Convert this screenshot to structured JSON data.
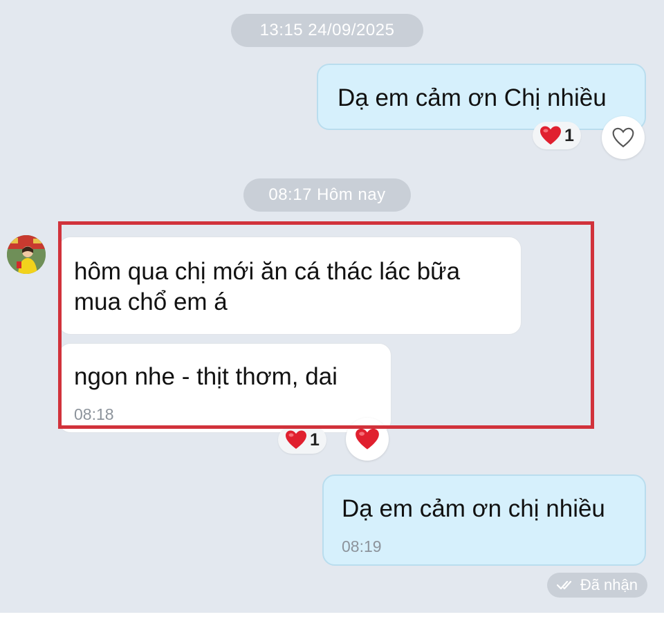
{
  "timestamps": {
    "first": "13:15 24/09/2025",
    "second": "08:17 Hôm nay"
  },
  "messages": [
    {
      "id": "m1",
      "direction": "out",
      "text": "Dạ em cảm ơn Chị nhiều",
      "reaction_count": "1"
    },
    {
      "id": "m2",
      "direction": "in",
      "text": "hôm qua chị mới ăn cá thác lác bữa mua chổ em á"
    },
    {
      "id": "m3",
      "direction": "in",
      "text": "ngon nhe - thịt thơm, dai",
      "time": "08:18",
      "reaction_count": "1"
    },
    {
      "id": "m4",
      "direction": "out",
      "text": "Dạ em cảm ơn chị nhiều",
      "time": "08:19"
    }
  ],
  "status": {
    "label": "Đã nhận"
  },
  "colors": {
    "background": "#e3e8ef",
    "outgoing_bubble": "#d6f0fc",
    "incoming_bubble": "#ffffff",
    "highlight": "#d1323b",
    "heart": "#e0202f"
  },
  "icons": {
    "reaction": "heart-icon",
    "add_reaction": "heart-outline-icon",
    "delivered": "double-check-icon"
  }
}
